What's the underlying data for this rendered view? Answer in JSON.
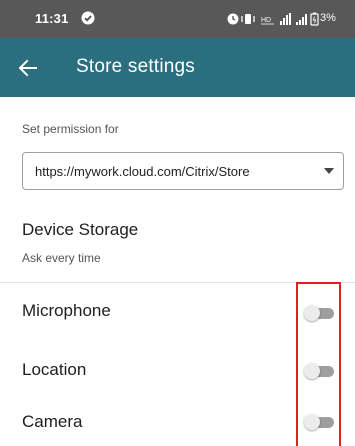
{
  "status_bar": {
    "time": "11:31",
    "battery": "3%",
    "icons": [
      "alarm-icon",
      "vibrate-icon",
      "volte-icon",
      "wifi-signal-icon",
      "cell-signal-icon",
      "battery-icon"
    ]
  },
  "app_bar": {
    "title": "Store settings",
    "back_icon": "arrow-left-icon",
    "background": "#2b6f7f"
  },
  "permission": {
    "label": "Set permission for",
    "selected_url": "https://mywork.cloud.com/Citrix/Store"
  },
  "device_storage": {
    "title": "Device Storage",
    "subtitle": "Ask every time"
  },
  "permissions": [
    {
      "label": "Microphone",
      "enabled": false
    },
    {
      "label": "Location",
      "enabled": false
    },
    {
      "label": "Camera",
      "enabled": false
    }
  ],
  "colors": {
    "status_bar": "#585858",
    "highlight": "#e02020"
  }
}
